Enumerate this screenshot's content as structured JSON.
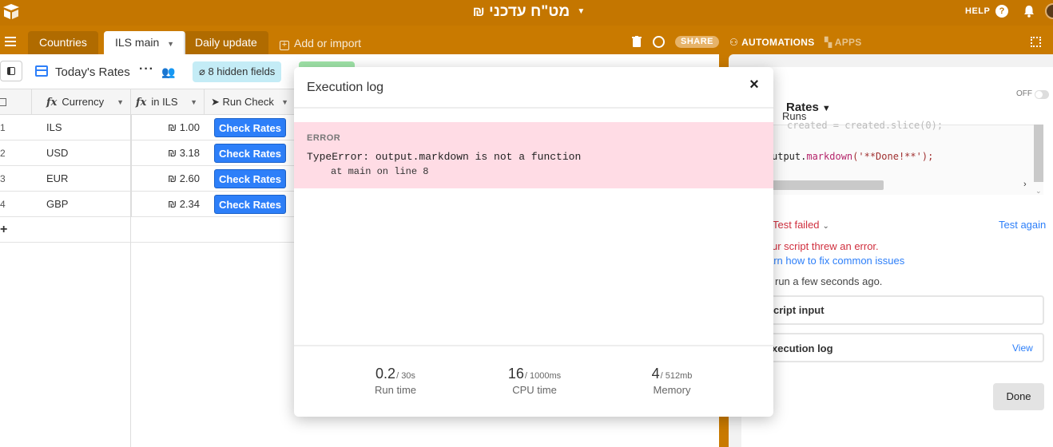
{
  "app": {
    "base_title": "מט\"ח עדכני",
    "help_label": "HELP"
  },
  "tabs": [
    {
      "label": "Countries"
    },
    {
      "label": "ILS main"
    },
    {
      "label": "Daily update"
    }
  ],
  "tabbar": {
    "add_import": "Add or import",
    "share": "SHARE",
    "automations": "AUTOMATIONS",
    "apps": "APPS"
  },
  "viewbar": {
    "view_name": "Today's Rates",
    "hidden_fields": "8 hidden fields"
  },
  "grid": {
    "columns": [
      "Currency",
      "in ILS",
      "Run Check"
    ],
    "rows": [
      {
        "num": "1",
        "currency": "ILS",
        "rate": "₪ 1.00",
        "button": "Check Rates"
      },
      {
        "num": "2",
        "currency": "USD",
        "rate": "₪ 3.18",
        "button": "Check Rates"
      },
      {
        "num": "3",
        "currency": "EUR",
        "rate": "₪ 2.60",
        "button": "Check Rates"
      },
      {
        "num": "4",
        "currency": "GBP",
        "rate": "₪ 2.34",
        "button": "Check Rates"
      }
    ],
    "add_row": "+"
  },
  "automation_panel": {
    "title": "Rates",
    "toggle_label": "OFF",
    "runs_tab": "Runs",
    "code_line1": "created = created.slice(0);",
    "code_line2_prefix": "utput.",
    "code_line2_fn": "markdown",
    "code_line2_arg": "('**Done!**');",
    "test_status": "Test failed",
    "test_again": "Test again",
    "error_line": "ur script threw an error.",
    "learn_link": "arn how to fix common issues",
    "ran_ago": "run a few seconds ago.",
    "script_input": "cript input",
    "execution_log": "xecution log",
    "view_link": "View",
    "done_button": "Done"
  },
  "modal": {
    "title": "Execution log",
    "error_label": "ERROR",
    "error_message": "TypeError: output.markdown is not a function",
    "error_trace": "at main on line 8",
    "stats": [
      {
        "value": "0.2",
        "limit": "/ 30s",
        "label": "Run time"
      },
      {
        "value": "16",
        "limit": "/ 1000ms",
        "label": "CPU time"
      },
      {
        "value": "4",
        "limit": "/ 512mb",
        "label": "Memory"
      }
    ]
  },
  "colors": {
    "brand": "#c47600",
    "accent_blue": "#2d7ff9",
    "error_bg": "#ffdce5",
    "error_text": "#d0303f"
  }
}
